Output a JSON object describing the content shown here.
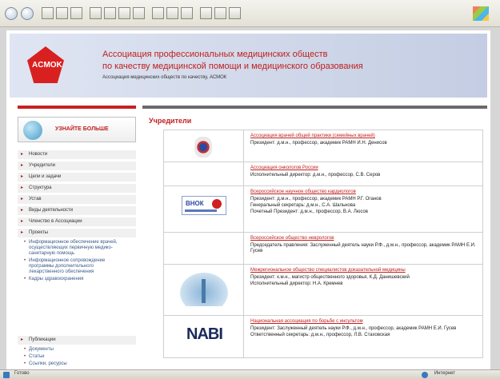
{
  "header": {
    "logo_text": "ACMOK",
    "title_line1": "Ассоциация профессиональных медицинских обществ",
    "title_line2": "по качеству медицинской помощи и медицинского образования",
    "subtitle": "Ассоциация медицинских обществ по качеству, АСМОК"
  },
  "sidebar": {
    "promo": "УЗНАЙТЕ БОЛЬШЕ",
    "items": [
      {
        "label": "Новости"
      },
      {
        "label": "Учредители"
      },
      {
        "label": "Цели и задачи"
      },
      {
        "label": "Структура"
      },
      {
        "label": "Устав"
      },
      {
        "label": "Виды деятельности"
      },
      {
        "label": "Членство в Ассоциации"
      },
      {
        "label": "Проекты"
      }
    ],
    "projects": [
      "Информационное обеспечение врачей, осуществляющих первичную медико-санитарную помощь",
      "Информационное сопровождение программы дополнительного лекарственного обеспечения",
      "Кадры здравоохранения"
    ],
    "publications": {
      "label": "Публикации",
      "items": [
        "Документы",
        "Статьи",
        "Ссылки, ресурсы"
      ]
    }
  },
  "content": {
    "title": "Учредители",
    "rows": [
      {
        "org": "Ассоциация врачей общей практики (семейных врачей)",
        "people": [
          "Президент: д.м.н., профессор, академик РАМН И.Н. Денисов"
        ]
      },
      {
        "org": "Ассоциация онкологов России",
        "people": [
          "Исполнительный директор: д.м.н., профессор, С.В. Серов"
        ]
      },
      {
        "org": "Всероссийское научное общество кардиологов",
        "logo_text": "ВНОК",
        "people": [
          "Президент: д.м.н., профессор, академик РАМН Р.Г. Оганов",
          "Генеральный секретарь: д.м.н., С.А. Шальнова",
          "Почетный Президент: д.м.н., профессор, В.А. Люсов"
        ]
      },
      {
        "org": "Всероссийское общество неврологов",
        "people": [
          "Председатель правления: Заслуженный деятель науки Р.Ф., д.м.н., профессор, академик РАМН Е.И. Гусев"
        ]
      },
      {
        "org": "Межрегиональное общество специалистов доказательной медицины",
        "people": [
          "Президент: к.м.н., магистр общественного здоровья, К.Д. Данишевский",
          "Исполнительный директор: Н.А. Кремнев"
        ]
      },
      {
        "org": "Национальная ассоциация по борьбе с инсультом",
        "logo_text": "NABI",
        "people": [
          "Президент: Заслуженный деятель науки Р.Ф., д.м.н., профессор, академик РАМН Е.И. Гусев",
          "Ответственный секретарь: д.м.н., профессор, Л.В. Стаховская"
        ]
      }
    ]
  },
  "statusbar": {
    "left": "Готово",
    "right": "Интернет"
  }
}
